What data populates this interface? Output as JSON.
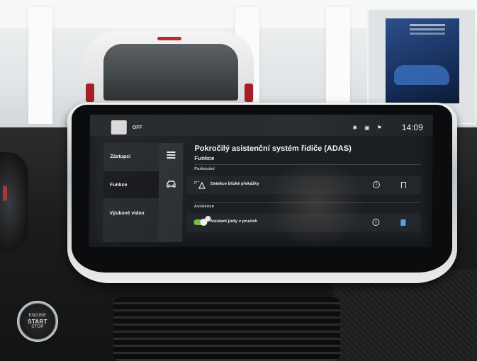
{
  "status_bar": {
    "off_label": "OFF",
    "time": "14:09",
    "icons": [
      "bluetooth-icon",
      "connected-car-icon",
      "signal-icon"
    ]
  },
  "sidebar": {
    "items": [
      {
        "label": "Zástupci",
        "active": false
      },
      {
        "label": "Funkce",
        "active": true
      },
      {
        "label": "Výukové video",
        "active": false
      }
    ]
  },
  "header": {
    "title": "Pokročilý asistenční systém řidiče (ADAS)",
    "subtitle": "Funkce"
  },
  "sections": [
    {
      "label": "Parkování",
      "rows": [
        {
          "icon": "proximity-sensor-icon",
          "label": "Detekce blízké překážky",
          "bookmark": "outline"
        }
      ]
    },
    {
      "label": "Asistence",
      "rows": [
        {
          "icon": "toggle-on",
          "label": "Asistent jízdy v pruzích",
          "bookmark": "filled"
        }
      ]
    }
  ],
  "colors": {
    "accent_blue": "#5aa0e0",
    "toggle_green": "#7cbf40",
    "screen_bg": "#1b1e22"
  },
  "start_button": {
    "line1": "ENGINE",
    "line2": "START",
    "line3": "STOP"
  }
}
